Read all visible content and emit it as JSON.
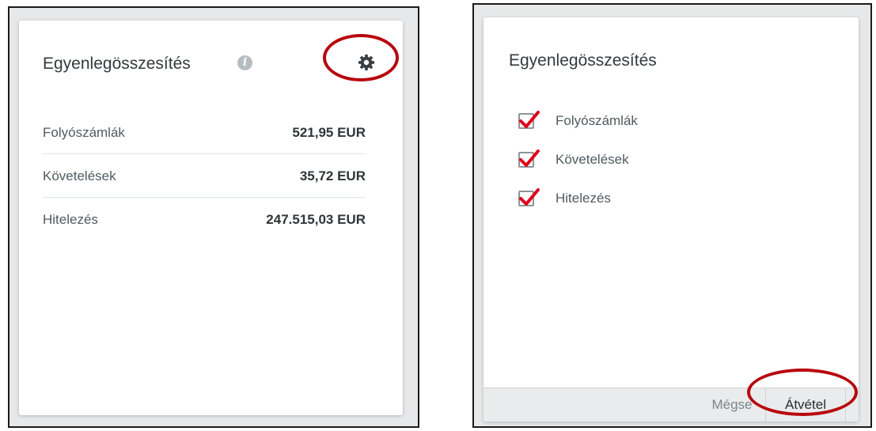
{
  "left_panel": {
    "title": "Egyenlegösszesítés",
    "info_icon": "info-icon",
    "settings_icon": "gear-icon",
    "rows": [
      {
        "label": "Folyószámlák",
        "value": "521,95 EUR"
      },
      {
        "label": "Követelések",
        "value": "35,72 EUR"
      },
      {
        "label": "Hitelezés",
        "value": "247.515,03 EUR"
      }
    ]
  },
  "right_panel": {
    "title": "Egyenlegösszesítés",
    "options": [
      {
        "label": "Folyószámlák",
        "checked": true
      },
      {
        "label": "Követelések",
        "checked": true
      },
      {
        "label": "Hitelezés",
        "checked": true
      }
    ],
    "cancel_label": "Mégse",
    "apply_label": "Átvétel"
  },
  "colors": {
    "highlight": "#b8050e",
    "checkmark": "#e0001a",
    "background": "#e6e8e9"
  }
}
